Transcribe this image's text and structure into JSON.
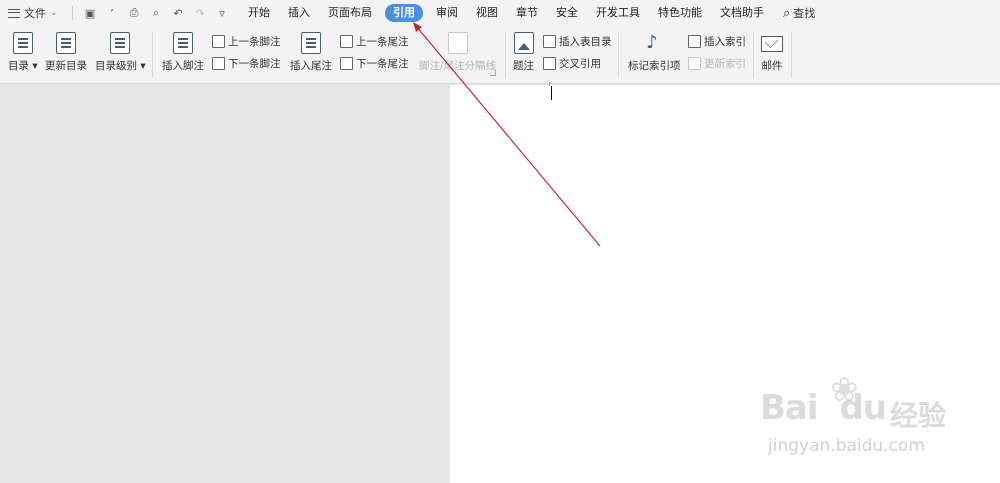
{
  "menubar": {
    "file_label": "文件",
    "tabs": [
      "开始",
      "插入",
      "页面布局",
      "引用",
      "审阅",
      "视图",
      "章节",
      "安全",
      "开发工具",
      "特色功能",
      "文档助手"
    ],
    "active_tab": "引用",
    "search_label": "查找"
  },
  "ribbon": {
    "toc_label": "目录",
    "update_toc_label": "更新目录",
    "toc_level_label": "目录级别",
    "insert_footnote_label": "插入脚注",
    "prev_footnote_label": "上一条脚注",
    "next_footnote_label": "下一条脚注",
    "insert_endnote_label": "插入尾注",
    "prev_endnote_label": "上一条尾注",
    "next_endnote_label": "下一条尾注",
    "separator_label": "脚注/尾注分隔线",
    "caption_label": "题注",
    "insert_table_of_figures_label": "插入表目录",
    "cross_reference_label": "交叉引用",
    "mark_index_label": "标记索引项",
    "insert_index_label": "插入索引",
    "update_index_label": "更新索引",
    "mail_label": "邮件"
  },
  "watermark": {
    "brand": "Bai",
    "brand_tail": "du",
    "brand_cn": "经验",
    "url": "jingyan.baidu.com"
  },
  "colors": {
    "active_tab": "#4a90e2",
    "arrow": "#c0272d",
    "page": "#ffffff",
    "background": "#e6e6e6"
  }
}
